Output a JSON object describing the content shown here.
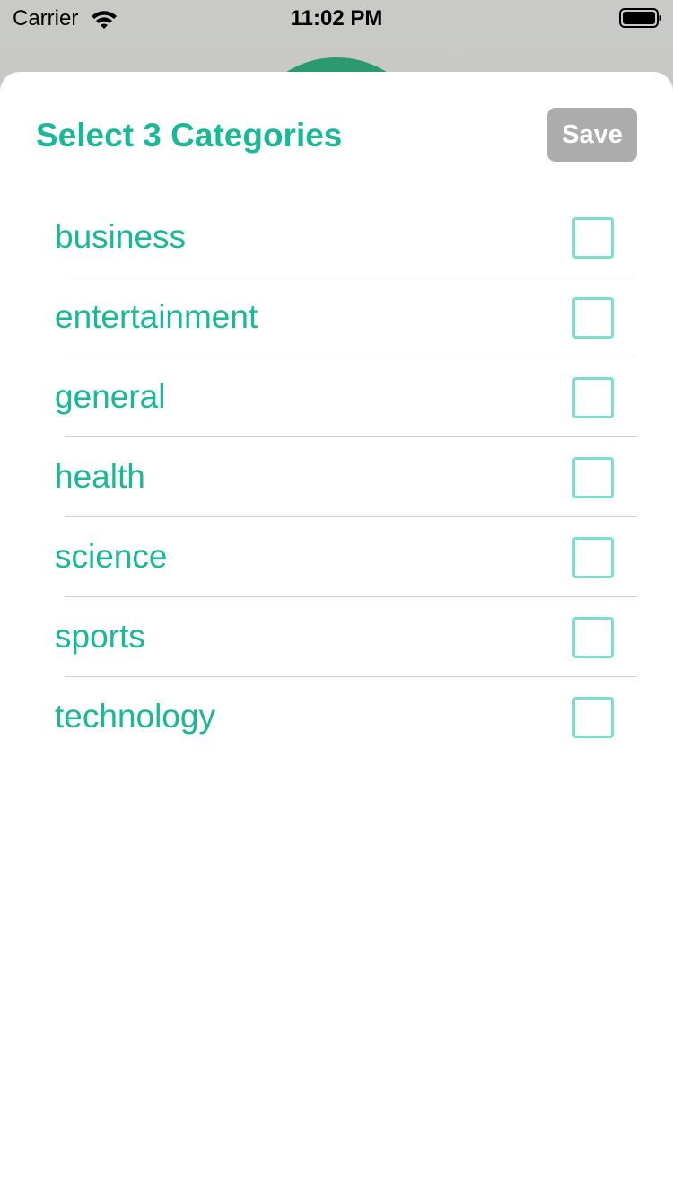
{
  "status_bar": {
    "carrier": "Carrier",
    "time": "11:02 PM",
    "wifi_icon": "wifi-icon",
    "battery_icon": "battery-icon"
  },
  "sheet": {
    "title": "Select 3 Categories",
    "save_label": "Save",
    "save_enabled": false
  },
  "categories": [
    {
      "label": "business",
      "checked": false
    },
    {
      "label": "entertainment",
      "checked": false
    },
    {
      "label": "general",
      "checked": false
    },
    {
      "label": "health",
      "checked": false
    },
    {
      "label": "science",
      "checked": false
    },
    {
      "label": "sports",
      "checked": false
    },
    {
      "label": "technology",
      "checked": false
    }
  ],
  "colors": {
    "accent": "#19b896",
    "checkbox_border": "#7adfcd",
    "save_disabled_bg": "#acacac",
    "backdrop_circle": "#2b9a72",
    "divider": "#cfcfcf"
  }
}
